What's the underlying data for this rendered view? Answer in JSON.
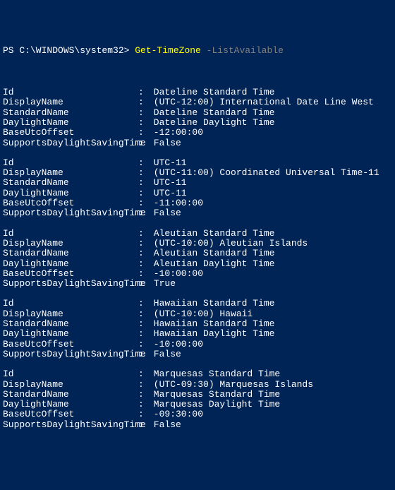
{
  "prompt": {
    "path": "PS C:\\WINDOWS\\system32> ",
    "cmdlet": "Get-TimeZone",
    "param": " -ListAvailable"
  },
  "labels": {
    "Id": "Id",
    "DisplayName": "DisplayName",
    "StandardName": "StandardName",
    "DaylightName": "DaylightName",
    "BaseUtcOffset": "BaseUtcOffset",
    "SupportsDaylightSavingTime": "SupportsDaylightSavingTime"
  },
  "colon": ":",
  "zones": [
    {
      "Id": "Dateline Standard Time",
      "DisplayName": "(UTC-12:00) International Date Line West",
      "StandardName": "Dateline Standard Time",
      "DaylightName": "Dateline Daylight Time",
      "BaseUtcOffset": "-12:00:00",
      "SupportsDaylightSavingTime": "False"
    },
    {
      "Id": "UTC-11",
      "DisplayName": "(UTC-11:00) Coordinated Universal Time-11",
      "StandardName": "UTC-11",
      "DaylightName": "UTC-11",
      "BaseUtcOffset": "-11:00:00",
      "SupportsDaylightSavingTime": "False"
    },
    {
      "Id": "Aleutian Standard Time",
      "DisplayName": "(UTC-10:00) Aleutian Islands",
      "StandardName": "Aleutian Standard Time",
      "DaylightName": "Aleutian Daylight Time",
      "BaseUtcOffset": "-10:00:00",
      "SupportsDaylightSavingTime": "True"
    },
    {
      "Id": "Hawaiian Standard Time",
      "DisplayName": "(UTC-10:00) Hawaii",
      "StandardName": "Hawaiian Standard Time",
      "DaylightName": "Hawaiian Daylight Time",
      "BaseUtcOffset": "-10:00:00",
      "SupportsDaylightSavingTime": "False"
    },
    {
      "Id": "Marquesas Standard Time",
      "DisplayName": "(UTC-09:30) Marquesas Islands",
      "StandardName": "Marquesas Standard Time",
      "DaylightName": "Marquesas Daylight Time",
      "BaseUtcOffset": "-09:30:00",
      "SupportsDaylightSavingTime": "False"
    }
  ]
}
